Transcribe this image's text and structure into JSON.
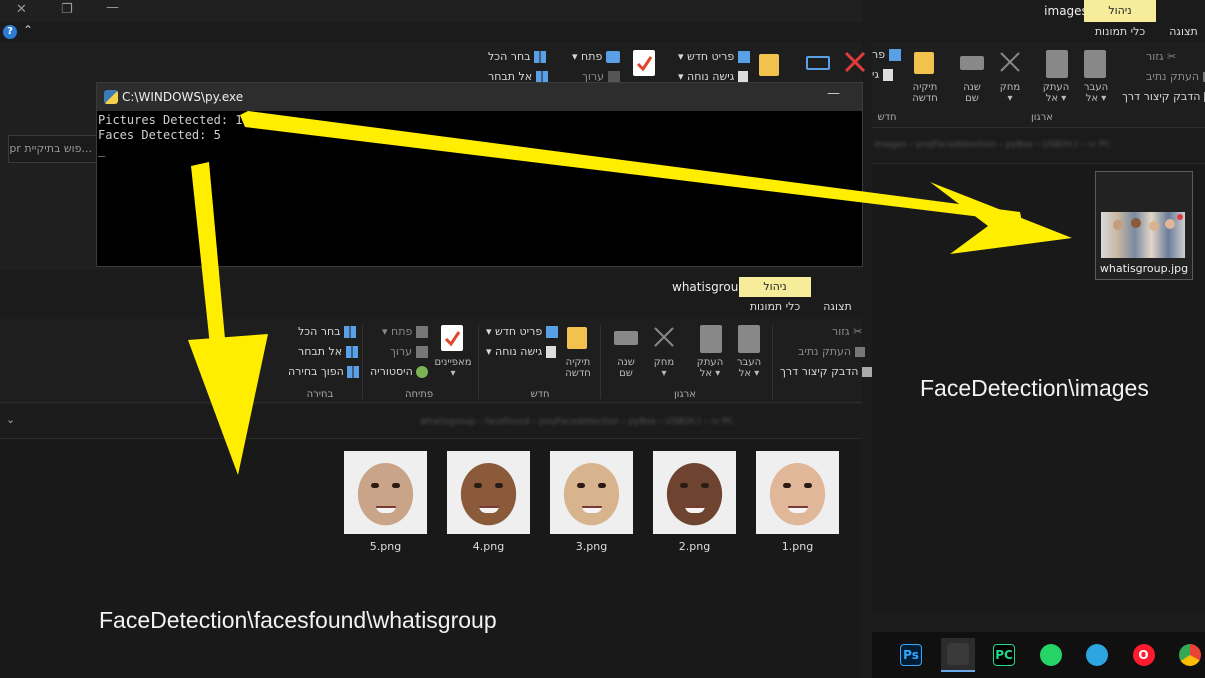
{
  "window_top": {
    "controls": {
      "close": "✕",
      "restore": "❐",
      "minimize": "—"
    },
    "ribbon": {
      "select_all": "בחר הכל",
      "select_none": "אל תבחר",
      "open": "פתח",
      "edit": "ערוך",
      "new_item": "פריט חדש",
      "easy_access": "גישה נוחה",
      "search_placeholder": "...פוש בתיקיית pr"
    }
  },
  "window_right": {
    "tab_manage": "ניהול",
    "tab_title": "images",
    "tab_view": "תצוגה",
    "tab_picture_tools": "כלי תמונות",
    "ribbon": {
      "cut": "גזור",
      "copy_path": "העתק נתיב",
      "paste_shortcut": "הדבק קיצור דרך",
      "move_to": "העבר",
      "move_to_2": "אל",
      "copy_to": "העתק",
      "copy_to_2": "אל",
      "delete": "מחק",
      "rename": "שנה",
      "rename_2": "שם",
      "new_folder": "תיקיה",
      "new_folder_2": "חדשה",
      "group_organize": "ארגון",
      "group_new": "חדש",
      "new_item_partial": "פר",
      "easy_access_partial": "גי"
    },
    "breadcrumb": "images › projFacedetection › pyBox › USB(H:) › זה PC",
    "file": {
      "name": "whatisgroup.jpg"
    },
    "caption": "FaceDetection\\images"
  },
  "console": {
    "title": "C:\\WINDOWS\\py.exe",
    "line1": "Pictures Detected: 1",
    "line2": "Faces Detected: 5",
    "cursor": "_"
  },
  "window_bottom": {
    "tab_manage": "ניהול",
    "tab_title": "whatisgroup",
    "tab_view": "תצוגה",
    "tab_picture_tools": "כלי תמונות",
    "ribbon": {
      "cut": "גזור",
      "copy_path": "העתק נתיב",
      "paste_shortcut": "הדבק קיצור דרך",
      "move_to": "העבר",
      "move_to_2": "אל",
      "copy_to": "העתק",
      "copy_to_2": "אל",
      "delete": "מחק",
      "rename": "שנה",
      "rename_2": "שם",
      "new_folder": "תיקיה",
      "new_folder_2": "חדשה",
      "new_item": "פריט חדש",
      "easy_access": "גישה נוחה",
      "properties": "מאפיינים",
      "open": "פתח",
      "edit": "ערוך",
      "history": "היסטוריה",
      "select_all": "בחר הכל",
      "select_none": "אל תבחר",
      "invert_selection": "הפוך בחירה",
      "group_organize": "ארגון",
      "group_new": "חדש",
      "group_open": "פתיחה",
      "group_select": "בחירה"
    },
    "breadcrumb": "whatisgroup › facefound › projFacedetection › pyBox › USB(H:) › זה PC",
    "files": [
      {
        "name": "5.png",
        "tone": "#c9a489"
      },
      {
        "name": "4.png",
        "tone": "#8a5a3a"
      },
      {
        "name": "3.png",
        "tone": "#d8b48e"
      },
      {
        "name": "2.png",
        "tone": "#6e4430"
      },
      {
        "name": "1.png",
        "tone": "#e1b79a"
      }
    ],
    "caption": "FaceDetection\\facesfound\\whatisgroup"
  },
  "taskbar": {
    "apps": [
      {
        "label": "Ps",
        "name": "photoshop-icon"
      },
      {
        "label": "",
        "name": "file-explorer-icon"
      },
      {
        "label": "PC",
        "name": "pycharm-icon"
      },
      {
        "label": "",
        "name": "whatsapp-icon"
      },
      {
        "label": "",
        "name": "telegram-icon"
      },
      {
        "label": "O",
        "name": "opera-icon"
      },
      {
        "label": "",
        "name": "chrome-icon"
      }
    ]
  },
  "annotation_color": "#ffee00"
}
